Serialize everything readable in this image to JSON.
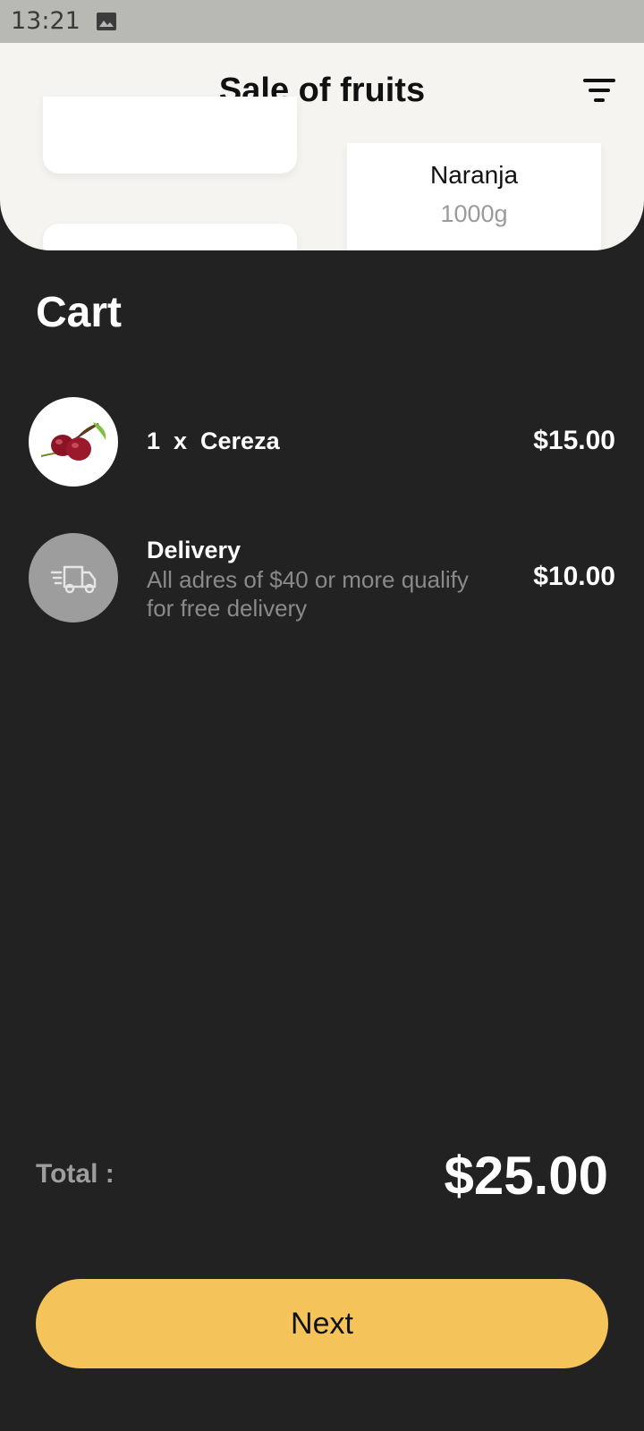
{
  "status_bar": {
    "time": "13:21",
    "icons": [
      "image-icon"
    ]
  },
  "header": {
    "title": "Sale of fruits",
    "icon": "filter-icon"
  },
  "products_preview": [
    {
      "name": "Naranja",
      "weight": "1000g"
    }
  ],
  "cart": {
    "title": "Cart",
    "items": [
      {
        "icon": "cherry-icon",
        "text": "1  x  Cereza",
        "price": "$15.00"
      }
    ],
    "delivery": {
      "icon": "truck-icon",
      "title": "Delivery",
      "description": "All adres of $40 or more qualify\nfor  free delivery",
      "price": "$10.00"
    }
  },
  "total": {
    "label": "Total :",
    "value": "$25.00"
  },
  "next_button": {
    "label": "Next"
  },
  "colors": {
    "background": "#222222",
    "sheet": "#f5f4f1",
    "accent": "#f4c35a"
  }
}
